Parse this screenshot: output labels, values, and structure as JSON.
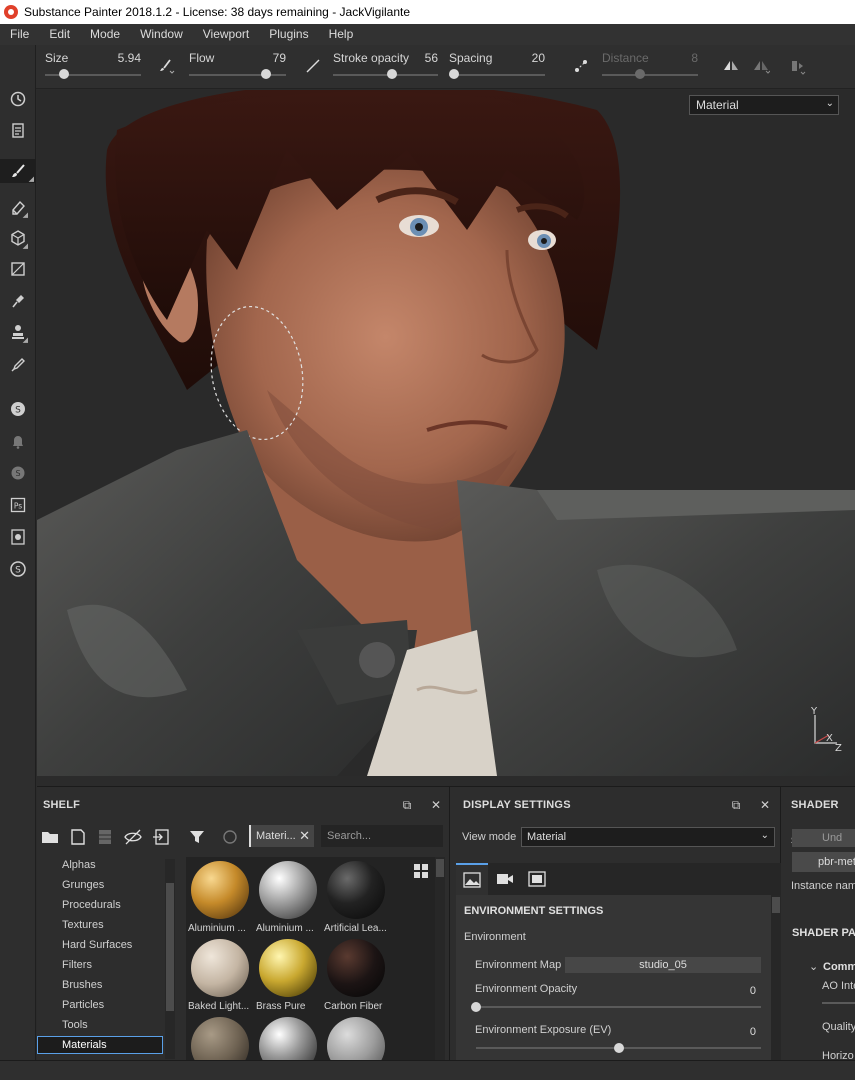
{
  "window": {
    "title": "Substance Painter 2018.1.2 - License: 38 days remaining - JackVigilante"
  },
  "menu": [
    "File",
    "Edit",
    "Mode",
    "Window",
    "Viewport",
    "Plugins",
    "Help"
  ],
  "tool_properties": {
    "size": {
      "label": "Size",
      "value": "5.94",
      "fraction": 0.2
    },
    "flow": {
      "label": "Flow",
      "value": "79",
      "fraction": 0.79
    },
    "stroke_opacity": {
      "label": "Stroke opacity",
      "value": "56",
      "fraction": 0.56
    },
    "spacing": {
      "label": "Spacing",
      "value": "20",
      "fraction": 0.05
    },
    "distance": {
      "label": "Distance",
      "value": "8",
      "fraction": 0.4
    }
  },
  "viewport": {
    "view_mode": "Material",
    "axis": {
      "y": "Y",
      "x": "X",
      "z": "Z"
    }
  },
  "shelf": {
    "title": "SHELF",
    "filter_chip": "Materi...",
    "search_placeholder": "Search...",
    "categories": [
      "Alphas",
      "Grunges",
      "Procedurals",
      "Textures",
      "Hard Surfaces",
      "Filters",
      "Brushes",
      "Particles",
      "Tools",
      "Materials"
    ],
    "selected_category": "Materials",
    "assets": [
      {
        "name": "Aluminium ..."
      },
      {
        "name": "Aluminium ..."
      },
      {
        "name": "Artificial Lea..."
      },
      {
        "name": "Baked Light..."
      },
      {
        "name": "Brass Pure"
      },
      {
        "name": "Carbon Fiber"
      },
      {
        "name": ""
      },
      {
        "name": ""
      },
      {
        "name": ""
      }
    ]
  },
  "display_settings": {
    "title": "DISPLAY SETTINGS",
    "view_mode_label": "View mode",
    "view_mode_value": "Material",
    "section": "ENVIRONMENT SETTINGS",
    "environment_label": "Environment",
    "env_map_label": "Environment Map",
    "env_map_value": "studio_05",
    "env_opacity_label": "Environment Opacity",
    "env_opacity_value": "0",
    "env_opacity_fraction": 0.0,
    "env_exposure_label": "Environment Exposure (EV)",
    "env_exposure_value": "0",
    "env_exposure_fraction": 0.5
  },
  "shader_settings": {
    "title": "SHADER SET",
    "undo_btn": "Und",
    "shader_btn": "pbr-met",
    "instance_label": "Instance nam",
    "params_title": "SHADER PA",
    "common_label": "Comm",
    "ao_label": "AO Inte",
    "quality_label": "Quality",
    "horizon_label": "Horizo"
  },
  "colors": {
    "accent": "#5aa0e8",
    "panel": "#2d2d2d",
    "viewport_bg": "#2a2a2a"
  }
}
